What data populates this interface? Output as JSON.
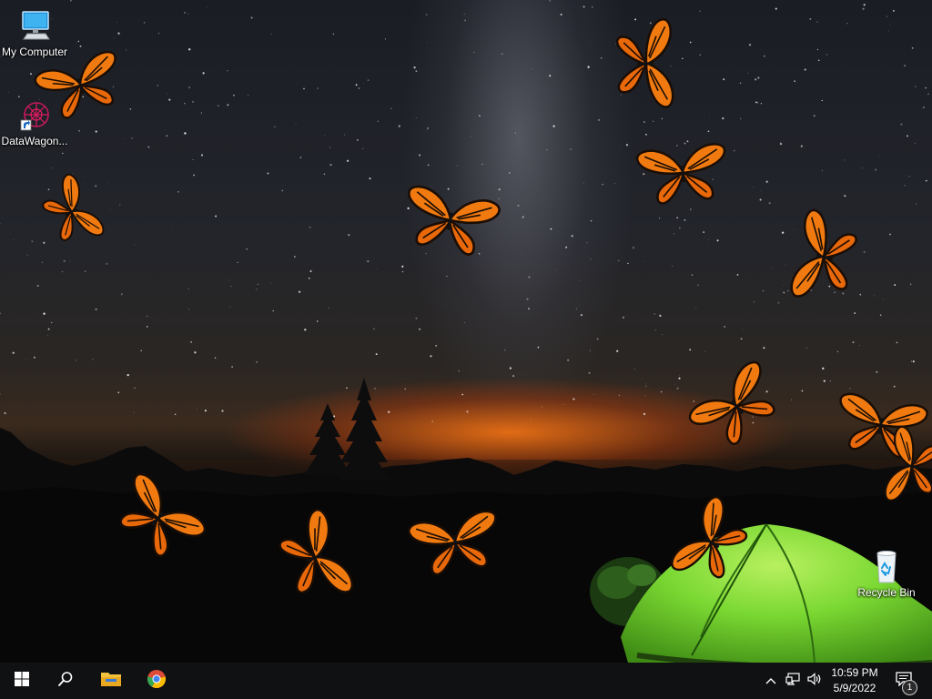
{
  "desktop": {
    "icons": [
      {
        "label": "My Computer",
        "icon": "monitor-icon"
      },
      {
        "label": "DataWagon...",
        "icon": "datawagon-shortcut-icon"
      },
      {
        "label": "Recycle Bin",
        "icon": "recycle-bin-icon"
      }
    ],
    "wallpaper": "night-sky-tent-butterflies"
  },
  "taskbar": {
    "start": {
      "icon": "windows-logo-icon"
    },
    "search": {
      "icon": "search-icon"
    },
    "pinned": [
      {
        "name": "File Explorer",
        "icon": "folder-icon"
      },
      {
        "name": "Google Chrome",
        "icon": "chrome-icon"
      }
    ],
    "tray": {
      "icons": [
        "chevron-up-icon",
        "network-icon",
        "volume-icon"
      ],
      "time": "10:59 PM",
      "date": "5/9/2022",
      "notifications_icon": "notification-icon",
      "notifications_count": "1"
    }
  },
  "colors": {
    "taskbar_bg": "#101113",
    "butterfly_orange": "#f07a10",
    "tent_green": "#6fd22b",
    "accent_blue": "#1a9ae0"
  }
}
